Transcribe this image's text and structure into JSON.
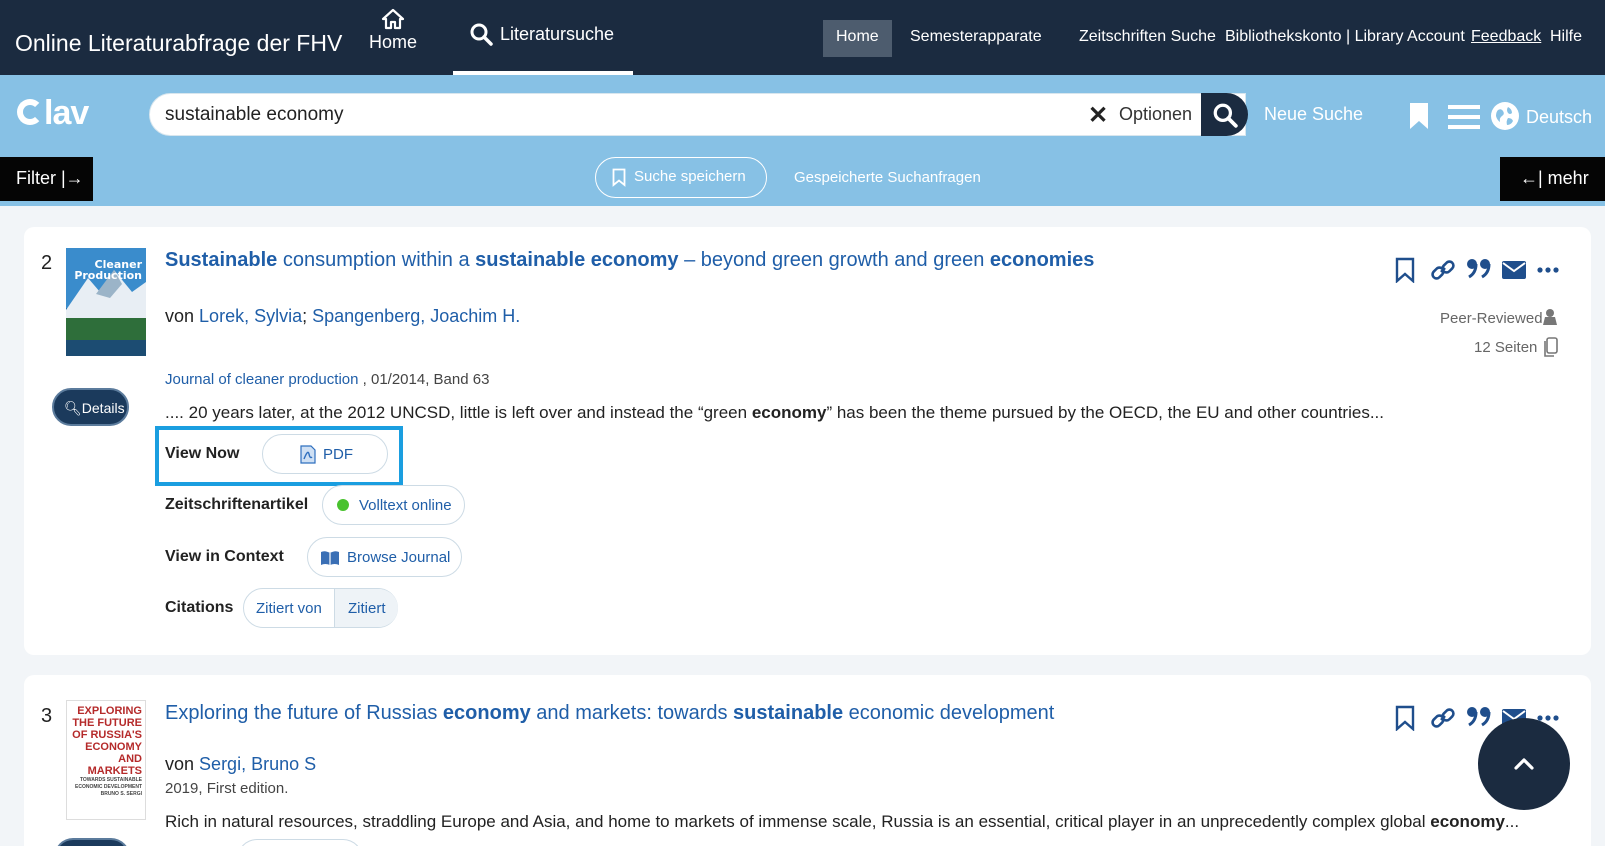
{
  "topbar": {
    "brand": "Online Literaturabfrage der FHV",
    "nav_home": "Home",
    "nav_literatursuche": "Literatursuche",
    "links": [
      "Home",
      "Semesterapparate",
      "Zeitschriften Suche",
      "Bibliothekskonto | Library Account",
      "Feedback",
      "Hilfe"
    ]
  },
  "search": {
    "logo": "lav",
    "query": "sustainable economy",
    "options": "Optionen",
    "new_search": "Neue Suche",
    "language": "Deutsch",
    "filter": "Filter |→",
    "more": "←| mehr",
    "save_search": "Suche speichern",
    "saved_searches": "Gespeicherte Suchanfragen"
  },
  "results": [
    {
      "number": "2",
      "cover_title": "Cleaner Production",
      "title_parts": [
        {
          "t": "Sustainable",
          "b": true
        },
        {
          "t": " consumption within a ",
          "b": false
        },
        {
          "t": "sustainable economy",
          "b": true
        },
        {
          "t": " – beyond green growth and green ",
          "b": false
        },
        {
          "t": "economies",
          "b": true
        }
      ],
      "by": "von",
      "authors": [
        "Lorek, Sylvia",
        "Spangenberg, Joachim H."
      ],
      "journal": "Journal of cleaner production",
      "issue": " , 01/2014, Band 63",
      "snippet_parts": [
        {
          "t": ".... 20 years later, at the 2012 UNCSD, little is left over and instead the “green ",
          "b": false
        },
        {
          "t": "economy",
          "b": true
        },
        {
          "t": "” has been the theme pursued by the OECD, the EU and other countries...",
          "b": false
        }
      ],
      "peer_reviewed": "Peer-Reviewed",
      "pages": "12 Seiten",
      "details": "Details",
      "view_now_label": "View Now",
      "pdf": "PDF",
      "type_label": "Zeitschriftenartikel",
      "fulltext": "Volltext online",
      "context_label": "View in Context",
      "browse_journal": "Browse Journal",
      "citations_label": "Citations",
      "cited_by": "Zitiert von",
      "cites": "Zitiert"
    },
    {
      "number": "3",
      "cover_lines": [
        "EXPLORING",
        "THE FUTURE",
        "OF RUSSIA'S",
        "ECONOMY",
        "AND",
        "MARKETS",
        "TOWARDS SUSTAINABLE",
        "ECONOMIC DEVELOPMENT",
        "BRUNO S. SERGI"
      ],
      "title_parts": [
        {
          "t": "Exploring the future of Russias ",
          "b": false
        },
        {
          "t": "economy",
          "b": true
        },
        {
          "t": " and markets: towards ",
          "b": false
        },
        {
          "t": "sustainable",
          "b": true
        },
        {
          "t": " economic development",
          "b": false
        }
      ],
      "by": "von",
      "authors": [
        "Sergi, Bruno S"
      ],
      "edition": "2019, First edition.",
      "snippet_parts": [
        {
          "t": "Rich in natural resources, straddling Europe and Asia, and home to markets of immense scale, Russia is an essential, critical player in an unprecedently complex global ",
          "b": false
        },
        {
          "t": "economy",
          "b": true
        },
        {
          "t": "...",
          "b": false
        }
      ]
    }
  ]
}
